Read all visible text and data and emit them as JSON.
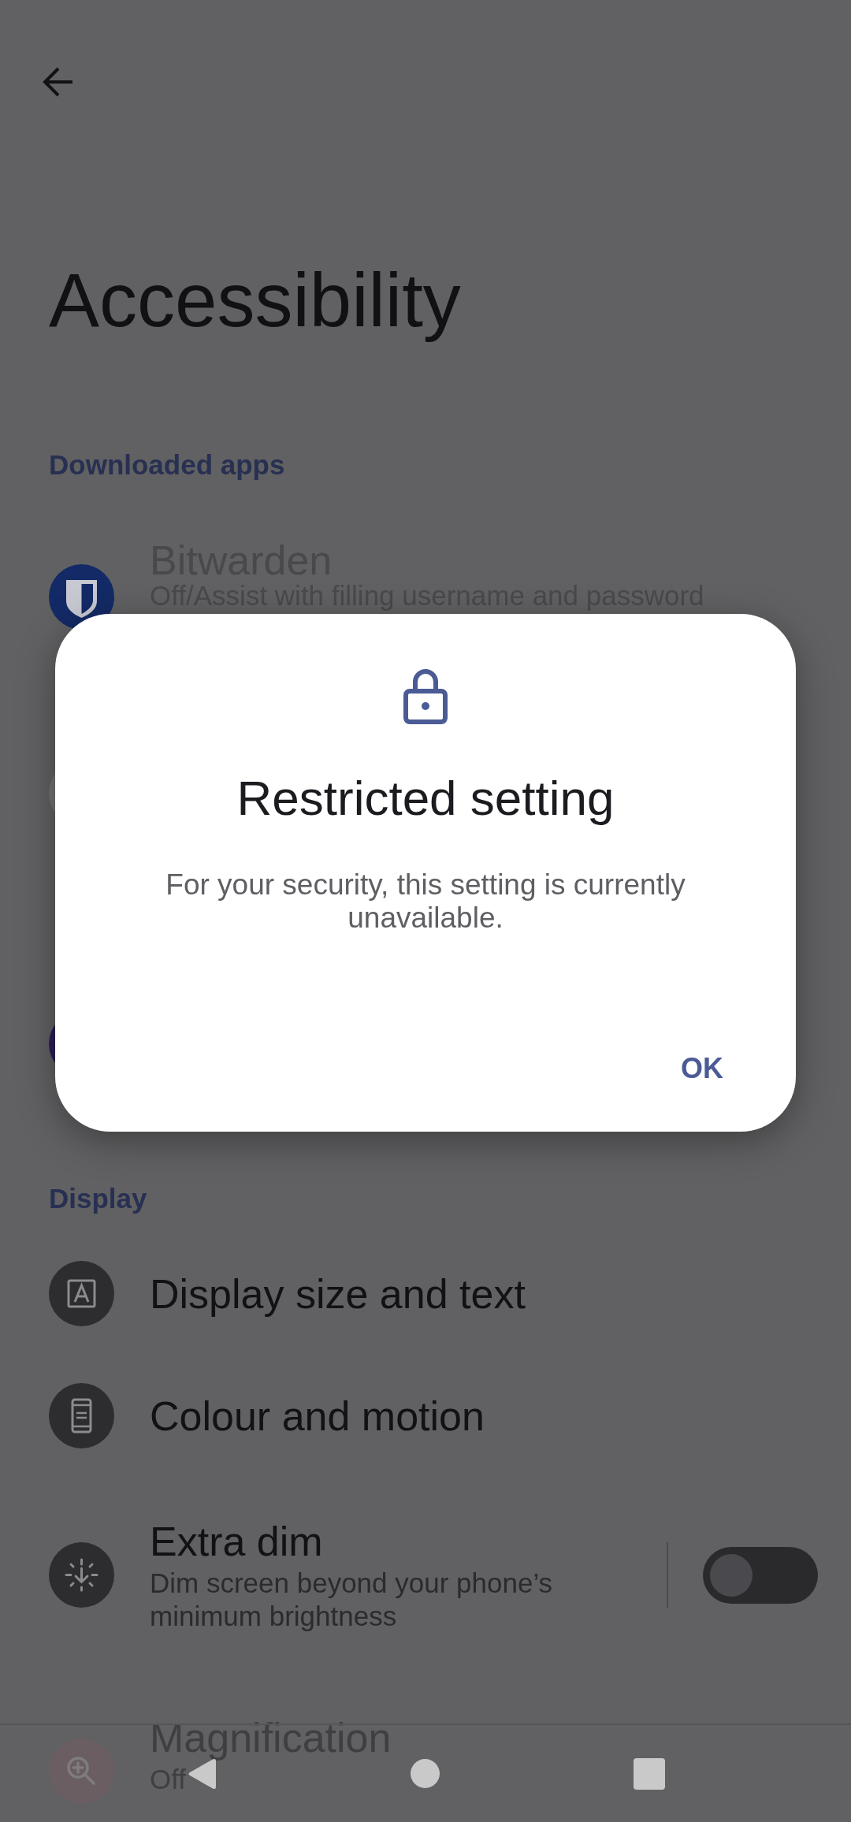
{
  "title": "Accessibility",
  "sections": [
    {
      "header": "Downloaded apps",
      "items": [
        {
          "kind": "item",
          "title": "Bitwarden",
          "subtitle": "Off/Assist with filling username and password",
          "disabled": true
        },
        {
          "kind": "covered"
        }
      ]
    },
    {
      "items": [
        {
          "kind": "covered"
        }
      ]
    },
    {
      "header": "Display",
      "items": [
        {
          "kind": "item",
          "title": "Display size and text",
          "disabled": false
        },
        {
          "kind": "item",
          "title": "Colour and motion",
          "disabled": false
        },
        {
          "kind": "switch",
          "title": "Extra dim",
          "subtitle": "Dim screen beyond your phone’s minimum brightness",
          "disabled": false,
          "on": false
        },
        {
          "kind": "item",
          "title": "Magnification",
          "subtitle": "Off",
          "disabled": false
        }
      ]
    }
  ],
  "dialog": {
    "title": "Restricted setting",
    "message": "For your security, this setting is currently unavailable.",
    "buttons": [
      "OK"
    ]
  }
}
